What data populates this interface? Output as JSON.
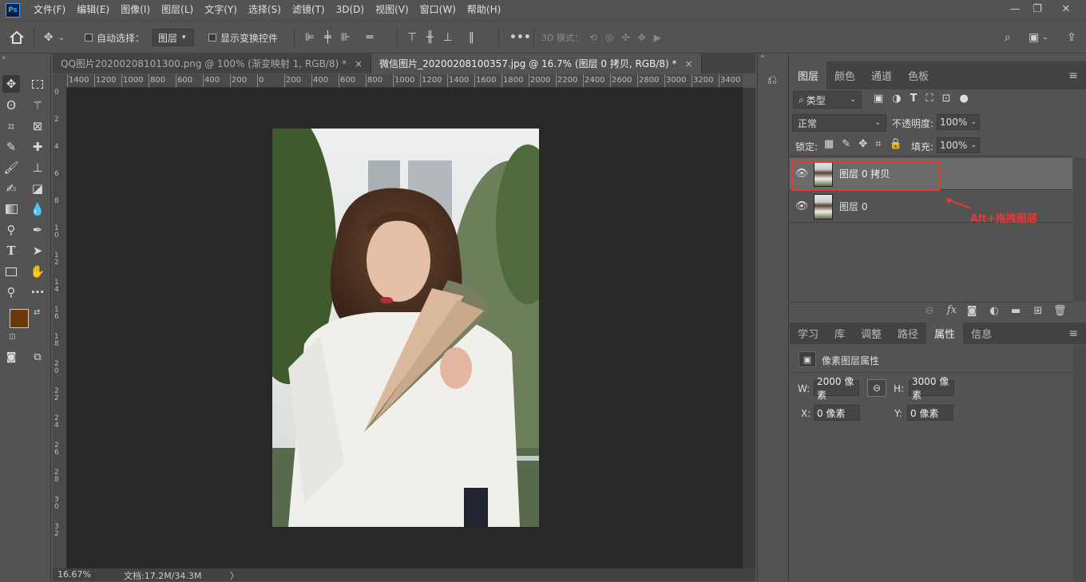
{
  "app": {
    "logo": "Ps"
  },
  "menu": [
    "文件(F)",
    "编辑(E)",
    "图像(I)",
    "图层(L)",
    "文字(Y)",
    "选择(S)",
    "滤镜(T)",
    "3D(D)",
    "视图(V)",
    "窗口(W)",
    "帮助(H)"
  ],
  "window_controls": {
    "minimize": "—",
    "restore": "❐",
    "close": "✕"
  },
  "options": {
    "auto_select_label": "自动选择：",
    "auto_select_value": "图层",
    "show_transform_label": "显示变换控件",
    "mode_3d_label": "3D 模式："
  },
  "tabs": [
    {
      "label": "QQ图片20200208101300.png @ 100% (渐变映射 1, RGB/8) *",
      "close": "×",
      "active": false
    },
    {
      "label": "微信图片_20200208100357.jpg @ 16.7% (图层 0 拷贝, RGB/8) *",
      "close": "×",
      "active": true
    }
  ],
  "ruler_h": [
    "1400",
    "1200",
    "1000",
    "800",
    "600",
    "400",
    "200",
    "0",
    "200",
    "400",
    "600",
    "800",
    "1000",
    "1200",
    "1400",
    "1600",
    "1800",
    "2000",
    "2200",
    "2400",
    "2600",
    "2800",
    "3000",
    "3200",
    "3400"
  ],
  "ruler_v": [
    "0",
    "2",
    "4",
    "6",
    "8",
    "1 0",
    "1 2",
    "1 4",
    "1 6",
    "1 8",
    "2 0",
    "2 2",
    "2 4",
    "2 6",
    "2 8",
    "3 0",
    "3 2"
  ],
  "status": {
    "zoom": "16.67%",
    "doc": "文档:17.2M/34.3M",
    "arrow": "〉"
  },
  "colors": {
    "foreground": "#6b3a08",
    "background": "#ffffff",
    "annotation": "#e53935"
  },
  "layers_panel": {
    "tabs": [
      "图层",
      "颜色",
      "通道",
      "色板"
    ],
    "filter_label": "类型",
    "blend_mode": "正常",
    "opacity_label": "不透明度:",
    "opacity_value": "100%",
    "lock_label": "锁定:",
    "fill_label": "填充:",
    "fill_value": "100%",
    "layers": [
      {
        "name": "图层 0 拷贝",
        "selected": true
      },
      {
        "name": "图层 0",
        "selected": false
      }
    ],
    "annotation": "Alt+拖拽图层"
  },
  "props_panel": {
    "tabs": [
      "学习",
      "库",
      "调整",
      "路径",
      "属性",
      "信息"
    ],
    "title": "像素图层属性",
    "w_label": "W:",
    "w_value": "2000 像素",
    "h_label": "H:",
    "h_value": "3000 像素",
    "x_label": "X:",
    "x_value": "0 像素",
    "y_label": "Y:",
    "y_value": "0 像素"
  }
}
